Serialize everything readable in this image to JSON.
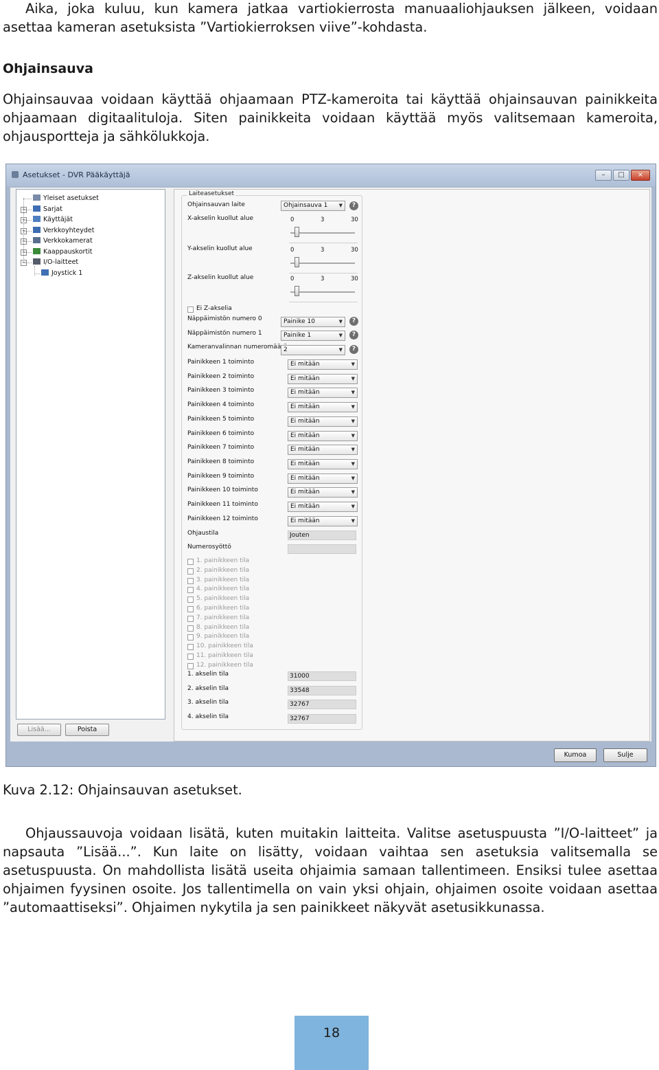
{
  "intro_paragraph": "Aika, joka kuluu, kun kamera jatkaa vartiokierrosta manuaaliohjauksen jälkeen, voidaan asettaa kameran asetuksista ”Vartiokierroksen viive”-kohdasta.",
  "section_heading": "Ohjainsauva",
  "section_paragraph": "Ohjainsauvaa voidaan käyttää ohjaamaan PTZ-kameroita tai käyttää ohjainsauvan painikkeita ohjaamaan digitaalituloja. Siten painikkeita voidaan käyttää myös valitsemaan kameroita, ohjausportteja ja sähkölukkoja.",
  "window": {
    "title": "Asetukset - DVR Pääkäyttäjä",
    "controls": {
      "minimize": "–",
      "maximize": "□",
      "close": "×"
    },
    "tree": [
      {
        "label": "Yleiset asetukset",
        "icon": "settings-icon"
      },
      {
        "label": "Sarjat",
        "icon": "arrows-icon"
      },
      {
        "label": "Käyttäjät",
        "icon": "users-icon"
      },
      {
        "label": "Verkkoyhteydet",
        "icon": "network-icon"
      },
      {
        "label": "Verkkokamerat",
        "icon": "camera-icon"
      },
      {
        "label": "Kaappauskortit",
        "icon": "card-icon"
      },
      {
        "label": "I/O-laitteet",
        "icon": "io-icon"
      },
      {
        "label": "Joystick 1",
        "icon": "arrows-icon"
      }
    ],
    "add_button": "Lisää...",
    "remove_button": "Poista",
    "group_title": "Laiteasetukset",
    "joystick_label": "Ohjainsauvan laite",
    "joystick_value": "Ohjainsauva 1",
    "axes": [
      {
        "label": "X-akselin kuollut alue",
        "ticks": [
          "0",
          "3",
          "30"
        ],
        "level": 0.07
      },
      {
        "label": "Y-akselin kuollut alue",
        "ticks": [
          "0",
          "3",
          "30"
        ],
        "level": 0.07
      },
      {
        "label": "Z-akselin kuollut alue",
        "ticks": [
          "0",
          "3",
          "30"
        ],
        "level": 0.07
      }
    ],
    "no_z_axis": "Ei Z-akselia",
    "keypad0_label": "Näppäimistön numero 0",
    "keypad0_value": "Painike 10",
    "keypad1_label": "Näppäimistön numero 1",
    "keypad1_value": "Painike 1",
    "camera_digits_label": "Kameranvalinnan numeromäärä",
    "camera_digits_value": "2",
    "button_functions": [
      {
        "label": "Painikkeen 1 toiminto",
        "value": "Ei mitään"
      },
      {
        "label": "Painikkeen 2 toiminto",
        "value": "Ei mitään"
      },
      {
        "label": "Painikkeen 3 toiminto",
        "value": "Ei mitään"
      },
      {
        "label": "Painikkeen 4 toiminto",
        "value": "Ei mitään"
      },
      {
        "label": "Painikkeen 5 toiminto",
        "value": "Ei mitään"
      },
      {
        "label": "Painikkeen 6 toiminto",
        "value": "Ei mitään"
      },
      {
        "label": "Painikkeen 7 toiminto",
        "value": "Ei mitään"
      },
      {
        "label": "Painikkeen 8 toiminto",
        "value": "Ei mitään"
      },
      {
        "label": "Painikkeen 9 toiminto",
        "value": "Ei mitään"
      },
      {
        "label": "Painikkeen 10 toiminto",
        "value": "Ei mitään"
      },
      {
        "label": "Painikkeen 11 toiminto",
        "value": "Ei mitään"
      },
      {
        "label": "Painikkeen 12 toiminto",
        "value": "Ei mitään"
      }
    ],
    "control_label": "Ohjaustila",
    "control_value": "Jouten",
    "number_input_label": "Numerosyöttö",
    "number_input_value": "",
    "button_states": [
      "1. painikkeen tila",
      "2. painikkeen tila",
      "3. painikkeen tila",
      "4. painikkeen tila",
      "5. painikkeen tila",
      "6. painikkeen tila",
      "7. painikkeen tila",
      "8. painikkeen tila",
      "9. painikkeen tila",
      "10. painikkeen tila",
      "11. painikkeen tila",
      "12. painikkeen tila"
    ],
    "axis_states": [
      {
        "label": "1. akselin tila",
        "value": "31000"
      },
      {
        "label": "2. akselin tila",
        "value": "33548"
      },
      {
        "label": "3. akselin tila",
        "value": "32767"
      },
      {
        "label": "4. akselin tila",
        "value": "32767"
      }
    ],
    "cancel_button": "Kumoa",
    "close_button": "Sulje"
  },
  "caption": "Kuva 2.12: Ohjainsauvan asetukset.",
  "body_paragraph": "Ohjaussauvoja voidaan lisätä, kuten muitakin laitteita. Valitse asetuspuusta ”I/O-laitteet” ja napsauta ”Lisää...”. Kun laite on lisätty, voidaan vaihtaa sen asetuksia valitsemalla se asetuspuusta. On mahdollista lisätä useita ohjaimia samaan tallentimeen. Ensiksi tulee asettaa ohjaimen fyysinen osoite. Jos tallentimella on vain yksi ohjain, ohjaimen osoite voidaan asettaa ”automaattiseksi”. Ohjaimen nykytila ja sen painikkeet näkyvät asetusikkunassa.",
  "page_number": "18"
}
